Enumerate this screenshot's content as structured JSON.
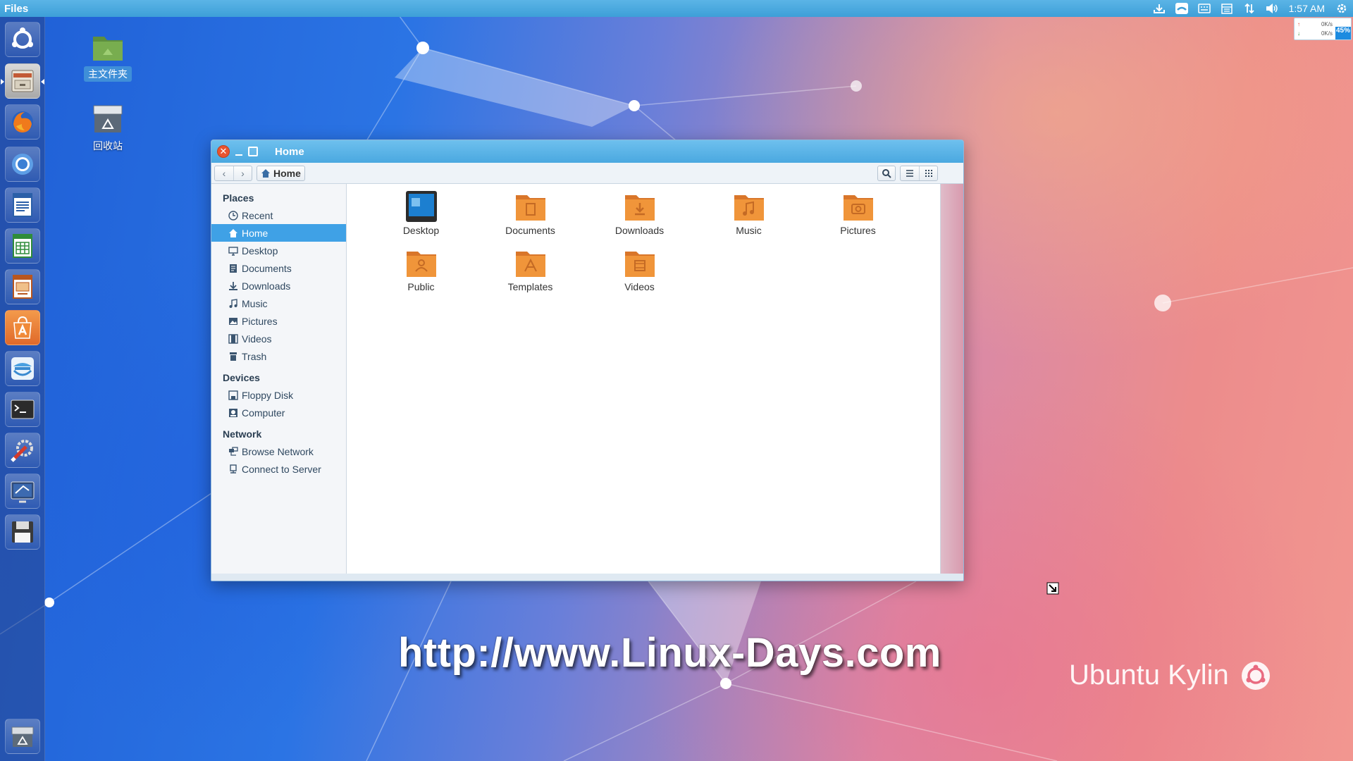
{
  "panel": {
    "app_name": "Files",
    "clock": "1:57 AM"
  },
  "netspeed": {
    "up": "0K/s",
    "down": "0K/s",
    "memory": "45%"
  },
  "desktop": {
    "icons": [
      {
        "label": "主文件夹"
      },
      {
        "label": "回收站"
      }
    ]
  },
  "window": {
    "title": "Home",
    "path_button": "Home"
  },
  "sidebar": {
    "places_header": "Places",
    "places": [
      {
        "label": "Recent"
      },
      {
        "label": "Home"
      },
      {
        "label": "Desktop"
      },
      {
        "label": "Documents"
      },
      {
        "label": "Downloads"
      },
      {
        "label": "Music"
      },
      {
        "label": "Pictures"
      },
      {
        "label": "Videos"
      },
      {
        "label": "Trash"
      }
    ],
    "devices_header": "Devices",
    "devices": [
      {
        "label": "Floppy Disk"
      },
      {
        "label": "Computer"
      }
    ],
    "network_header": "Network",
    "network": [
      {
        "label": "Browse Network"
      },
      {
        "label": "Connect to Server"
      }
    ]
  },
  "files": [
    {
      "name": "Desktop"
    },
    {
      "name": "Documents"
    },
    {
      "name": "Downloads"
    },
    {
      "name": "Music"
    },
    {
      "name": "Pictures"
    },
    {
      "name": "Public"
    },
    {
      "name": "Templates"
    },
    {
      "name": "Videos"
    }
  ],
  "watermark": "http://www.Linux-Days.com",
  "brand": "Ubuntu Kylin",
  "colors": {
    "accent": "#3fa1e6",
    "folder": "#f0953a",
    "close": "#e9542f"
  }
}
